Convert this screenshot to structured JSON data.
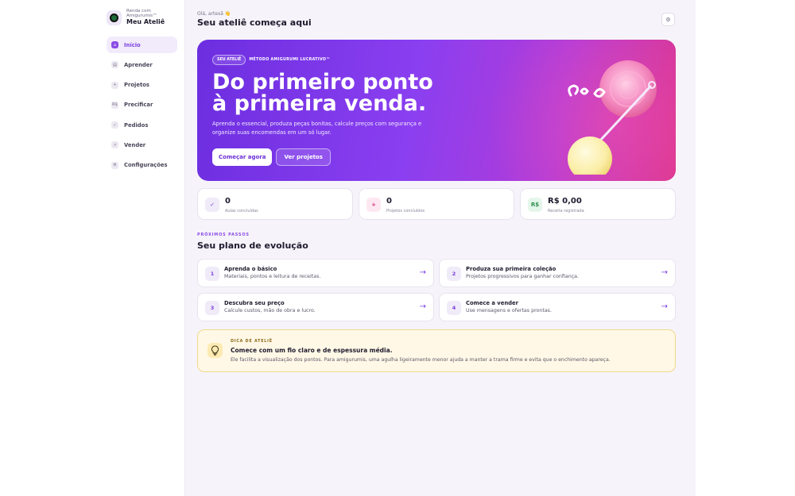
{
  "brand": {
    "subtitle": "Renda com Amigurumis™",
    "name": "Meu Ateliê",
    "icon": "yarn-logo-icon"
  },
  "nav": {
    "items": [
      {
        "label": "Início",
        "icon": "home-icon",
        "active": true
      },
      {
        "label": "Aprender",
        "icon": "book-icon",
        "active": false
      },
      {
        "label": "Projetos",
        "icon": "plus-icon",
        "active": false
      },
      {
        "label": "Precificar",
        "icon": "currency-icon",
        "active": false
      },
      {
        "label": "Pedidos",
        "icon": "check-icon",
        "active": false
      },
      {
        "label": "Vender",
        "icon": "arrow-icon",
        "active": false
      },
      {
        "label": "Configurações",
        "icon": "gear-icon",
        "active": false
      }
    ]
  },
  "header": {
    "greeting": "Olá, artesã 👋",
    "title": "Seu ateliê começa aqui",
    "settings_icon": "gear-icon"
  },
  "hero": {
    "badge": "SEU ATELIÊ",
    "tagline": "MÉTODO AMIGURUMI LUCRATIVO™",
    "title_line1": "Do primeiro ponto",
    "title_line2": "à primeira venda.",
    "description": "Aprenda o essencial, produza peças bonitas, calcule preços com segurança e organize suas encomendas em um só lugar.",
    "primary_button": "Começar agora",
    "secondary_button": "Ver projetos"
  },
  "stats": [
    {
      "value": "0",
      "label": "Aulas concluídas",
      "icon": "check-icon",
      "glyph": "✓",
      "color": "#7b3fe0",
      "bg": "#f0ebf8"
    },
    {
      "value": "0",
      "label": "Projetos concluídos",
      "icon": "plus-icon",
      "glyph": "+",
      "color": "#d6337f",
      "bg": "#fde8f1"
    },
    {
      "value": "R$ 0,00",
      "label": "Receita registrada",
      "icon": "currency-icon",
      "glyph": "R$",
      "color": "#2f8f4e",
      "bg": "#e5f6ea"
    }
  ],
  "plan": {
    "eyebrow": "PRÓXIMOS PASSOS",
    "title": "Seu plano de evolução",
    "steps": [
      {
        "num": "1",
        "title": "Aprenda o básico",
        "desc": "Materiais, pontos e leitura de receitas."
      },
      {
        "num": "2",
        "title": "Produza sua primeira coleção",
        "desc": "Projetos progressivos para ganhar confiança."
      },
      {
        "num": "3",
        "title": "Descubra seu preço",
        "desc": "Calcule custos, mão de obra e lucro."
      },
      {
        "num": "4",
        "title": "Comece a vender",
        "desc": "Use mensagens e ofertas prontas."
      }
    ]
  },
  "tip": {
    "eyebrow": "DICA DE ATELIÊ",
    "title": "Comece com um fio claro e de espessura média.",
    "body": "Ele facilita a visualização dos pontos. Para amigurumis, uma agulha ligeiramente menor ajuda a manter a trama firme e evita que o enchimento apareça.",
    "icon": "lightbulb-icon"
  }
}
